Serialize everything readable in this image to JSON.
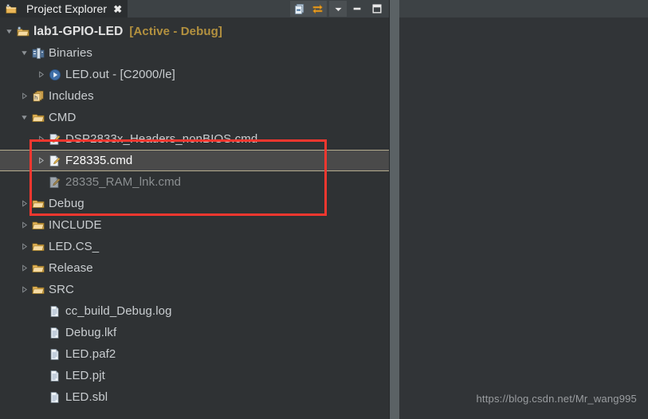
{
  "window": {
    "background": "#2f3234",
    "panel_background": "#313437",
    "accent_red": "#f4372f",
    "selection_background": "#4a4a4a",
    "selection_border": "#b5ac8e",
    "gold_text": "#b3913f"
  },
  "tab": {
    "title": "Project Explorer",
    "close_label": "✖",
    "icon": "project-explorer-icon"
  },
  "toolbar": {
    "buttons": [
      {
        "name": "collapse-all-button",
        "icon": "collapse-all-icon",
        "tooltip": "Collapse All"
      },
      {
        "name": "link-with-editor-button",
        "icon": "link-with-editor-icon",
        "tooltip": "Link with Editor"
      },
      {
        "name": "view-menu-button",
        "icon": "chevron-down-icon",
        "tooltip": "View Menu"
      },
      {
        "name": "minimize-button",
        "icon": "minimize-icon",
        "tooltip": "Minimize"
      },
      {
        "name": "maximize-button",
        "icon": "maximize-icon",
        "tooltip": "Maximize"
      }
    ]
  },
  "tree": {
    "rows": [
      {
        "label": "lab1-GPIO-LED",
        "suffix": "[Active - Debug]",
        "icon": "open-project-icon",
        "indent": 0,
        "twisty": "expanded",
        "style": "project",
        "name": "tree-item-project"
      },
      {
        "label": "Binaries",
        "icon": "binaries-icon",
        "indent": 1,
        "twisty": "expanded",
        "style": "normal",
        "name": "tree-item-binaries"
      },
      {
        "label": "LED.out - [C2000/le]",
        "icon": "executable-icon",
        "indent": 2,
        "twisty": "collapsed",
        "style": "normal",
        "name": "tree-item-led-out"
      },
      {
        "label": "Includes",
        "icon": "includes-icon",
        "indent": 1,
        "twisty": "collapsed",
        "style": "normal",
        "name": "tree-item-includes"
      },
      {
        "label": "CMD",
        "icon": "folder-icon",
        "indent": 1,
        "twisty": "expanded",
        "style": "normal",
        "name": "tree-item-cmd"
      },
      {
        "label": "DSP2833x_Headers_nonBIOS.cmd",
        "icon": "linker-command-file-icon",
        "indent": 2,
        "twisty": "collapsed",
        "style": "normal",
        "name": "tree-item-dsp2833x-headers-nonbios-cmd"
      },
      {
        "label": "F28335.cmd",
        "icon": "linker-command-file-icon",
        "indent": 2,
        "twisty": "collapsed",
        "style": "selected",
        "selected": true,
        "name": "tree-item-f28335-cmd"
      },
      {
        "label": "28335_RAM_lnk.cmd",
        "icon": "linker-command-file-excluded-icon",
        "indent": 2,
        "twisty": "none",
        "style": "dim",
        "name": "tree-item-28335-ram-lnk-cmd"
      },
      {
        "label": "Debug",
        "icon": "folder-icon",
        "indent": 1,
        "twisty": "collapsed",
        "style": "normal",
        "name": "tree-item-debug"
      },
      {
        "label": "INCLUDE",
        "icon": "folder-icon",
        "indent": 1,
        "twisty": "collapsed",
        "style": "normal",
        "name": "tree-item-include"
      },
      {
        "label": "LED.CS_",
        "icon": "folder-icon",
        "indent": 1,
        "twisty": "collapsed",
        "style": "normal",
        "name": "tree-item-led-cs"
      },
      {
        "label": "Release",
        "icon": "folder-icon",
        "indent": 1,
        "twisty": "collapsed",
        "style": "normal",
        "name": "tree-item-release"
      },
      {
        "label": "SRC",
        "icon": "folder-icon",
        "indent": 1,
        "twisty": "collapsed",
        "style": "normal",
        "name": "tree-item-src"
      },
      {
        "label": "cc_build_Debug.log",
        "icon": "file-icon",
        "indent": 2,
        "twisty": "none",
        "style": "normal",
        "name": "tree-item-cc-build-debug-log"
      },
      {
        "label": "Debug.lkf",
        "icon": "file-icon",
        "indent": 2,
        "twisty": "none",
        "style": "normal",
        "name": "tree-item-debug-lkf"
      },
      {
        "label": "LED.paf2",
        "icon": "file-icon",
        "indent": 2,
        "twisty": "none",
        "style": "normal",
        "name": "tree-item-led-paf2"
      },
      {
        "label": "LED.pjt",
        "icon": "file-icon",
        "indent": 2,
        "twisty": "none",
        "style": "normal",
        "name": "tree-item-led-pjt"
      },
      {
        "label": "LED.sbl",
        "icon": "file-icon",
        "indent": 2,
        "twisty": "none",
        "style": "normal",
        "name": "tree-item-led-sbl"
      }
    ]
  },
  "annotation": {
    "shape": "rectangle",
    "color": "#f4372f",
    "highlights": [
      "DSP2833x_Headers_nonBIOS.cmd",
      "F28335.cmd",
      "28335_RAM_lnk.cmd"
    ]
  },
  "watermark": {
    "text": "https://blog.csdn.net/Mr_wang995"
  }
}
